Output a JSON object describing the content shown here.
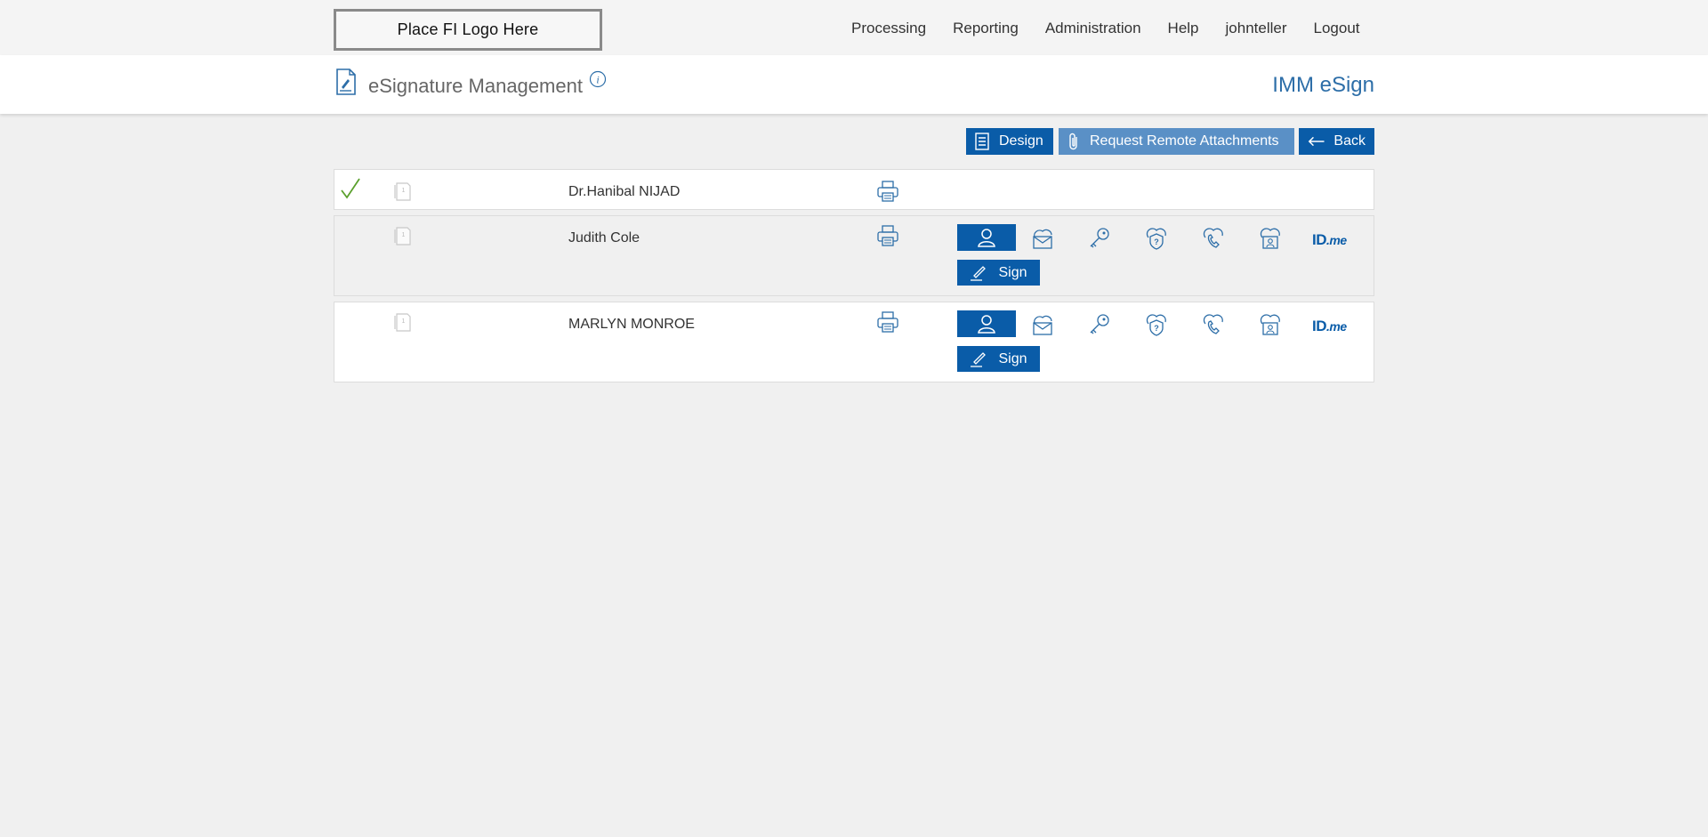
{
  "header": {
    "logo_text": "Place FI Logo Here",
    "nav": [
      "Processing",
      "Reporting",
      "Administration",
      "Help",
      "johnteller",
      "Logout"
    ]
  },
  "titlebar": {
    "page_title": "eSignature Management",
    "app_name": "IMM eSign"
  },
  "toolbar": {
    "design_label": "Design",
    "remote_attachments_label": "Request Remote Attachments",
    "back_label": "Back"
  },
  "signers": [
    {
      "name": "Dr.Hanibal NIJAD",
      "signed": true,
      "doc_count": "1"
    },
    {
      "name": "Judith Cole",
      "signed": false,
      "doc_count": "1",
      "sign_label": "Sign",
      "idme_main": "ID",
      "idme_suffix": ".me"
    },
    {
      "name": "MARLYN MONROE",
      "signed": false,
      "doc_count": "1",
      "sign_label": "Sign",
      "idme_main": "ID",
      "idme_suffix": ".me"
    }
  ],
  "colors": {
    "accent": "#0a5ca8",
    "accent_light": "#5a90c6",
    "check": "#5aa02c",
    "app_name": "#2d6ea8"
  }
}
